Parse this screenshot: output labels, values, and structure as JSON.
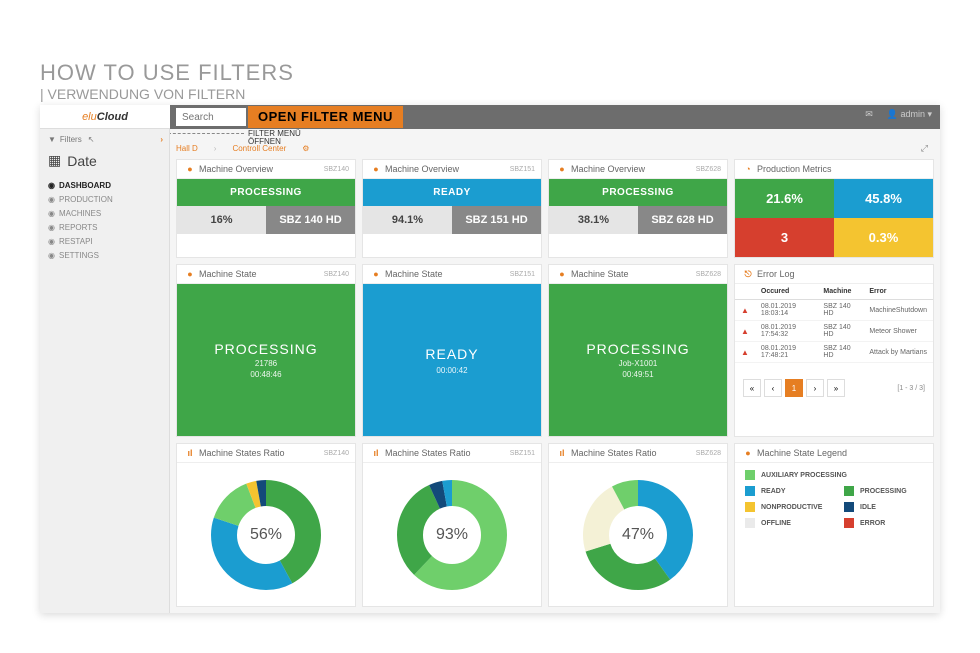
{
  "slide": {
    "title": "HOW TO USE FILTERS",
    "subtitle": "| VERWENDUNG VON FILTERN"
  },
  "callout": {
    "text": "OPEN FILTER MENU",
    "sub1": "FILTER MENÜ",
    "sub2": "ÖFFNEN"
  },
  "logo": {
    "a": "elu",
    "b": "Cloud"
  },
  "search": {
    "placeholder": "Search"
  },
  "user": {
    "name": "admin"
  },
  "sidebar": {
    "filters": "Filters",
    "date": "Date",
    "nav": [
      {
        "label": "DASHBOARD",
        "active": true
      },
      {
        "label": "PRODUCTION"
      },
      {
        "label": "MACHINES"
      },
      {
        "label": "REPORTS"
      },
      {
        "label": "RESTAPI"
      },
      {
        "label": "SETTINGS"
      }
    ]
  },
  "breadcrumb": {
    "a": "Hall D",
    "b": "Controll Center"
  },
  "overview": [
    {
      "title": "Machine Overview",
      "tag": "SBZ140",
      "state": "PROCESSING",
      "cls": "green",
      "pct": "16%",
      "model": "SBZ 140 HD"
    },
    {
      "title": "Machine Overview",
      "tag": "SBZ151",
      "state": "READY",
      "cls": "blue",
      "pct": "94.1%",
      "model": "SBZ 151 HD"
    },
    {
      "title": "Machine Overview",
      "tag": "SBZ628",
      "state": "PROCESSING",
      "cls": "green",
      "pct": "38.1%",
      "model": "SBZ 628 HD"
    }
  ],
  "prodmetrics": {
    "title": "Production Metrics",
    "a": "21.6%",
    "b": "45.8%",
    "c": "3",
    "d": "0.3%"
  },
  "states": [
    {
      "title": "Machine State",
      "tag": "SBZ140",
      "state": "PROCESSING",
      "cls": "green",
      "sub1": "21786",
      "sub2": "00:48:46"
    },
    {
      "title": "Machine State",
      "tag": "SBZ151",
      "state": "READY",
      "cls": "blue",
      "sub1": "",
      "sub2": "00:00:42"
    },
    {
      "title": "Machine State",
      "tag": "SBZ628",
      "state": "PROCESSING",
      "cls": "green",
      "sub1": "Job-X1001",
      "sub2": "00:49:51"
    }
  ],
  "errlog": {
    "title": "Error Log",
    "cols": {
      "a": "Occured",
      "b": "Machine",
      "c": "Error"
    },
    "rows": [
      {
        "t": "08.01.2019 18:03:14",
        "m": "SBZ 140 HD",
        "e": "MachineShutdown"
      },
      {
        "t": "08.01.2019 17:54:32",
        "m": "SBZ 140 HD",
        "e": "Meteor Shower"
      },
      {
        "t": "08.01.2019 17:48:21",
        "m": "SBZ 140 HD",
        "e": "Attack by Martians"
      }
    ],
    "pager": {
      "cur": "1",
      "info": "[1 - 3 / 3]"
    }
  },
  "ratio": [
    {
      "title": "Machine States Ratio",
      "tag": "SBZ140",
      "pct": "56%"
    },
    {
      "title": "Machine States Ratio",
      "tag": "SBZ151",
      "pct": "93%"
    },
    {
      "title": "Machine States Ratio",
      "tag": "SBZ628",
      "pct": "47%"
    }
  ],
  "legend": {
    "title": "Machine State Legend",
    "items": [
      {
        "c": "#6fcf6b",
        "l": "AUXILIARY PROCESSING"
      },
      {
        "c": "#1b9dd0",
        "l": "READY"
      },
      {
        "c": "#3fa648",
        "l": "PROCESSING"
      },
      {
        "c": "#f4c430",
        "l": "NONPRODUCTIVE"
      },
      {
        "c": "#134a7a",
        "l": "IDLE"
      },
      {
        "c": "#eaeaea",
        "l": "OFFLINE"
      },
      {
        "c": "#d63f2e",
        "l": "ERROR"
      }
    ]
  },
  "chart_data": [
    {
      "type": "pie",
      "title": "Machine States Ratio SBZ140",
      "center_label": "56%",
      "series": [
        {
          "name": "PROCESSING",
          "value": 42,
          "color": "#3fa648"
        },
        {
          "name": "READY",
          "value": 38,
          "color": "#1b9dd0"
        },
        {
          "name": "AUXILIARY PROCESSING",
          "value": 14,
          "color": "#6fcf6b"
        },
        {
          "name": "NONPRODUCTIVE",
          "value": 3,
          "color": "#f4c430"
        },
        {
          "name": "IDLE",
          "value": 3,
          "color": "#134a7a"
        }
      ]
    },
    {
      "type": "pie",
      "title": "Machine States Ratio SBZ151",
      "center_label": "93%",
      "series": [
        {
          "name": "AUXILIARY PROCESSING",
          "value": 62,
          "color": "#6fcf6b"
        },
        {
          "name": "PROCESSING",
          "value": 31,
          "color": "#3fa648"
        },
        {
          "name": "IDLE",
          "value": 4,
          "color": "#134a7a"
        },
        {
          "name": "READY",
          "value": 3,
          "color": "#1b9dd0"
        }
      ]
    },
    {
      "type": "pie",
      "title": "Machine States Ratio SBZ628",
      "center_label": "47%",
      "series": [
        {
          "name": "READY",
          "value": 40,
          "color": "#1b9dd0"
        },
        {
          "name": "PROCESSING",
          "value": 30,
          "color": "#3fa648"
        },
        {
          "name": "OFFLINE",
          "value": 22,
          "color": "#f4f1d6"
        },
        {
          "name": "AUXILIARY PROCESSING",
          "value": 8,
          "color": "#6fcf6b"
        }
      ]
    }
  ]
}
